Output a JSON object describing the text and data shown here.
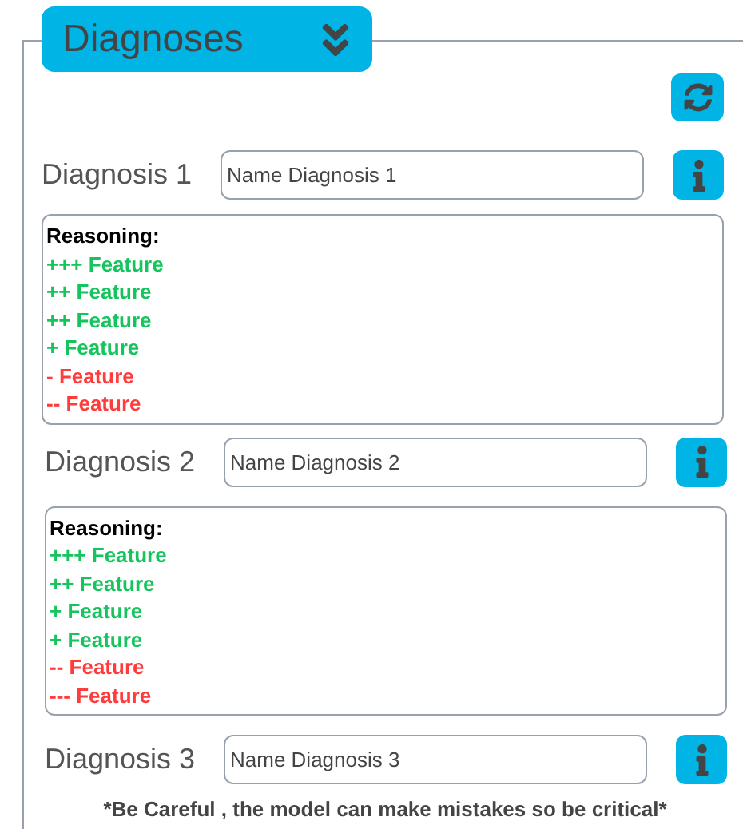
{
  "header": {
    "title": "Diagnoses"
  },
  "diagnoses": [
    {
      "label": "Diagnosis 1",
      "placeholder": "Name Diagnosis 1",
      "reasoning": {
        "title": "Reasoning:",
        "features": [
          {
            "text": "+++ Feature",
            "kind": "positive"
          },
          {
            "text": "++ Feature",
            "kind": "positive"
          },
          {
            "text": "++ Feature",
            "kind": "positive"
          },
          {
            "text": "+ Feature",
            "kind": "positive"
          },
          {
            "text": "- Feature",
            "kind": "negative"
          },
          {
            "text": "-- Feature",
            "kind": "negative"
          }
        ]
      }
    },
    {
      "label": "Diagnosis 2",
      "placeholder": "Name Diagnosis 2",
      "reasoning": {
        "title": "Reasoning:",
        "features": [
          {
            "text": "+++ Feature",
            "kind": "positive"
          },
          {
            "text": "++ Feature",
            "kind": "positive"
          },
          {
            "text": "+ Feature",
            "kind": "positive"
          },
          {
            "text": "+ Feature",
            "kind": "positive"
          },
          {
            "text": "-- Feature",
            "kind": "negative"
          },
          {
            "text": "--- Feature",
            "kind": "negative"
          }
        ]
      }
    },
    {
      "label": "Diagnosis 3",
      "placeholder": "Name Diagnosis 3"
    }
  ],
  "warning": "*Be Careful , the model can make mistakes so be critical*"
}
